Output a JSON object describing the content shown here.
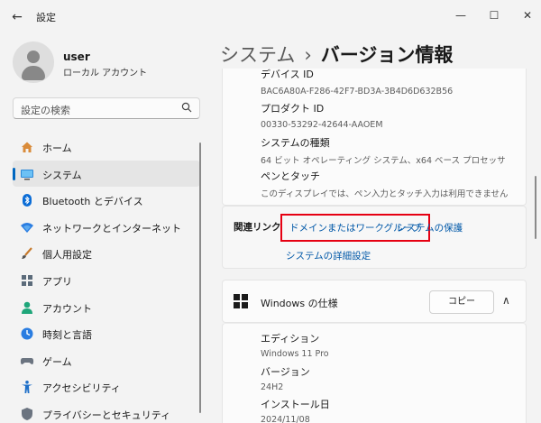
{
  "window": {
    "title": "設定",
    "back_icon": "←",
    "minimize_icon": "—",
    "maximize_icon": "☐",
    "close_icon": "✕"
  },
  "user": {
    "name": "user",
    "account_type": "ローカル アカウント"
  },
  "search": {
    "placeholder": "設定の検索",
    "icon": "⚲"
  },
  "sidebar": {
    "items": [
      {
        "label": "ホーム",
        "icon": "home-icon"
      },
      {
        "label": "システム",
        "icon": "system-icon",
        "selected": true
      },
      {
        "label": "Bluetooth とデバイス",
        "icon": "bluetooth-icon"
      },
      {
        "label": "ネットワークとインターネット",
        "icon": "network-icon"
      },
      {
        "label": "個人用設定",
        "icon": "brush-icon"
      },
      {
        "label": "アプリ",
        "icon": "apps-icon"
      },
      {
        "label": "アカウント",
        "icon": "account-icon"
      },
      {
        "label": "時刻と言語",
        "icon": "time-language-icon"
      },
      {
        "label": "ゲーム",
        "icon": "gaming-icon"
      },
      {
        "label": "アクセシビリティ",
        "icon": "accessibility-icon"
      },
      {
        "label": "プライバシーとセキュリティ",
        "icon": "privacy-icon"
      }
    ]
  },
  "header": {
    "breadcrumb_parent": "システム",
    "separator": "›",
    "breadcrumb_current": "バージョン情報"
  },
  "device_specs": {
    "rows": [
      {
        "label": "デバイス ID",
        "value": "BAC6A80A-F286-42F7-BD3A-3B4D6D632B56"
      },
      {
        "label": "プロダクト ID",
        "value": "00330-53292-42644-AAOEM"
      },
      {
        "label": "システムの種類",
        "value": "64 ビット オペレーティング システム、x64 ベース プロセッサ"
      },
      {
        "label": "ペンとタッチ",
        "value": "このディスプレイでは、ペン入力とタッチ入力は利用できません"
      }
    ]
  },
  "related_links": {
    "label": "関連リンク",
    "domain_link": "ドメインまたはワークグループ",
    "protection_link": "システムの保護",
    "advanced_link": "システムの詳細設定",
    "highlight_color": "#e60012"
  },
  "windows_spec": {
    "title": "Windows の仕様",
    "copy_label": "コピー",
    "collapse_icon": "∧",
    "rows": [
      {
        "label": "エディション",
        "value": "Windows 11 Pro"
      },
      {
        "label": "バージョン",
        "value": "24H2"
      },
      {
        "label": "インストール日",
        "value": "2024/11/08"
      }
    ]
  },
  "colors": {
    "accent": "#0067c0",
    "link": "#0058a8",
    "background": "#f3f3f3"
  }
}
